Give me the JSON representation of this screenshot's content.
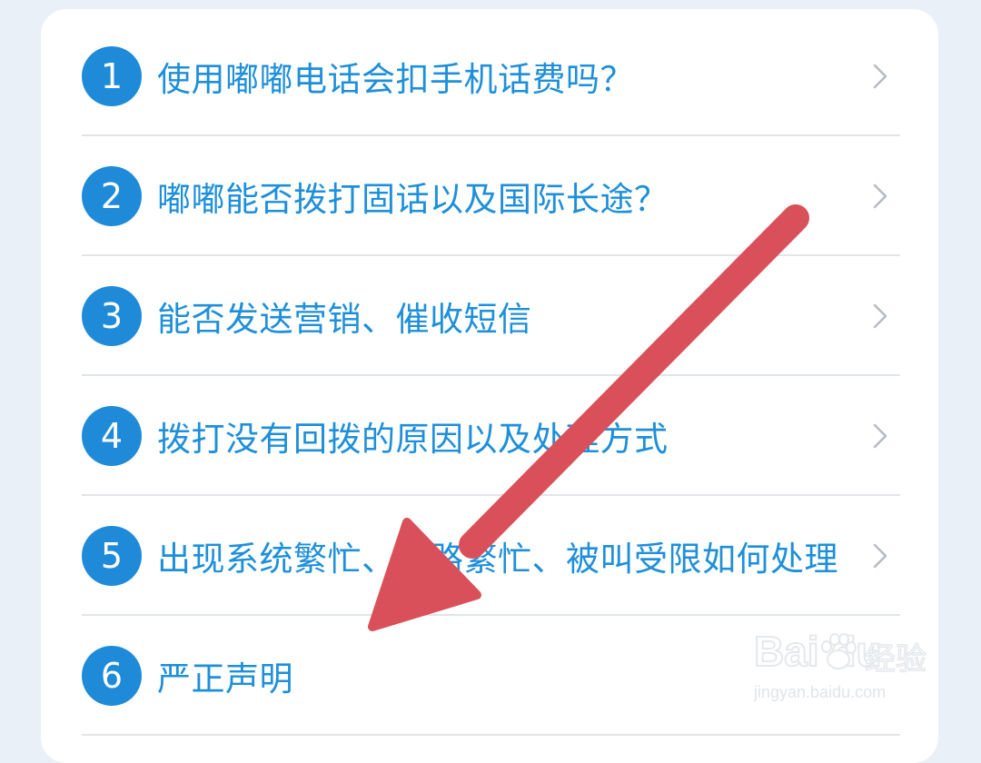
{
  "faq": {
    "items": [
      {
        "number": "1",
        "label": "使用嘟嘟电话会扣手机话费吗？"
      },
      {
        "number": "2",
        "label": "嘟嘟能否拨打固话以及国际长途？"
      },
      {
        "number": "3",
        "label": "能否发送营销、催收短信"
      },
      {
        "number": "4",
        "label": "拨打没有回拨的原因以及处理方式"
      },
      {
        "number": "5",
        "label": "出现系统繁忙、线路繁忙、被叫受限如何处理"
      },
      {
        "number": "6",
        "label": "严正声明"
      }
    ]
  },
  "watermark": {
    "brand": "Bai du",
    "cn": "经验",
    "url": "jingyan.baidu.com"
  },
  "colors": {
    "accent": "#1f8bd8",
    "text": "#1e8fd9",
    "arrow": "#d9505a",
    "background": "#e9f0f8"
  },
  "icons": {
    "chevron": "chevron-right-icon",
    "arrow": "annotation-arrow-icon",
    "paw": "baidu-paw-icon"
  }
}
